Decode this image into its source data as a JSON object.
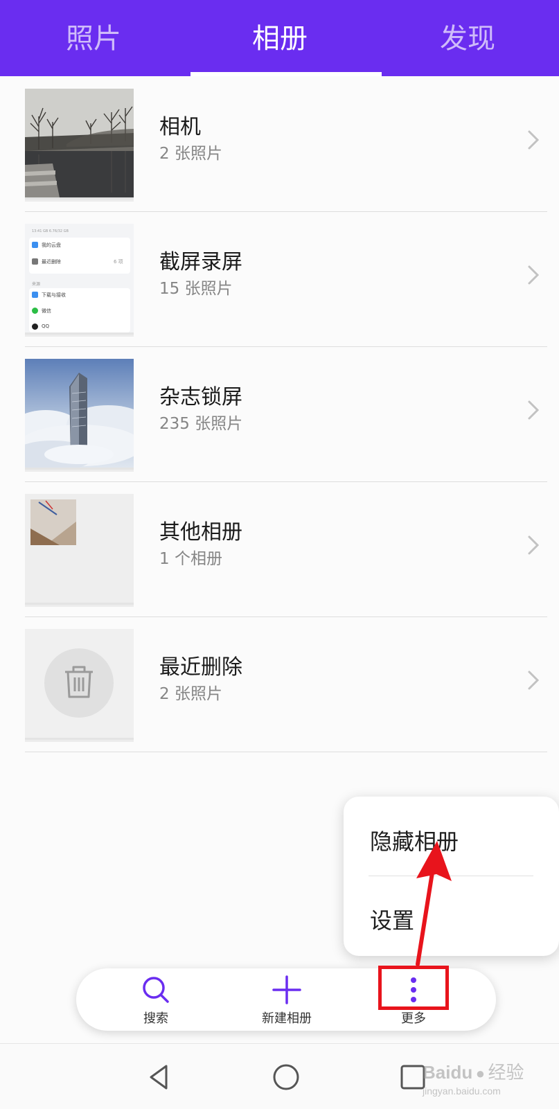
{
  "tabs": {
    "photos": "照片",
    "albums": "相册",
    "discover": "发现",
    "active": "albums"
  },
  "albums": [
    {
      "name": "相机",
      "count": "2 张照片",
      "thumb": "lake-trees-photo"
    },
    {
      "name": "截屏录屏",
      "count": "15 张照片",
      "thumb": "screenshot-thumbnail"
    },
    {
      "name": "杂志锁屏",
      "count": "235 张照片",
      "thumb": "skyscraper-clouds-photo"
    },
    {
      "name": "其他相册",
      "count": "1 个相册",
      "thumb": "other-albums-collage"
    },
    {
      "name": "最近删除",
      "count": "2 张照片",
      "thumb": "trash-icon"
    }
  ],
  "screenshot_thumb": {
    "status": "13:41 GB 6.76/32 GB",
    "row1": "我的云盘",
    "row2": "最近删除",
    "row2_count": "6 项",
    "section": "来源",
    "row3": "下载与接收",
    "row4": "微信",
    "row5": "QQ"
  },
  "popup_menu": {
    "hidden_albums": "隐藏相册",
    "settings": "设置"
  },
  "bottom_bar": {
    "search": "搜索",
    "new_album": "新建相册",
    "more": "更多"
  },
  "watermark": {
    "brand": "Baidu",
    "brand_cn": "经验",
    "url": "jingyan.baidu.com"
  },
  "colors": {
    "accent": "#6a2df0",
    "annotation": "#e8141c"
  }
}
